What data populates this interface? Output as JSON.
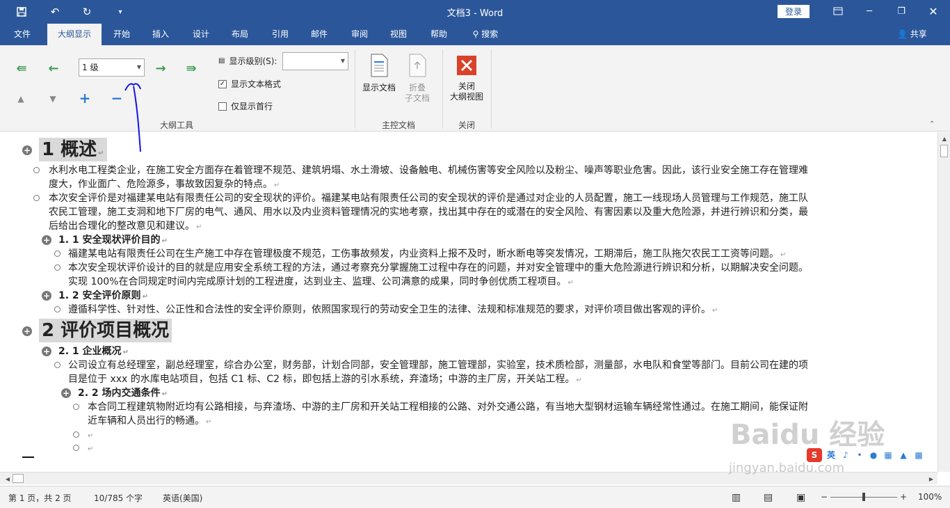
{
  "window": {
    "title": "文档3  -  Word",
    "login": "登录"
  },
  "tabs": [
    {
      "label": "文件"
    },
    {
      "label": "大纲显示"
    },
    {
      "label": "开始"
    },
    {
      "label": "插入"
    },
    {
      "label": "设计"
    },
    {
      "label": "布局"
    },
    {
      "label": "引用"
    },
    {
      "label": "邮件"
    },
    {
      "label": "审阅"
    },
    {
      "label": "视图"
    },
    {
      "label": "帮助"
    },
    {
      "label": "搜索"
    }
  ],
  "share_label": "共享",
  "ribbon": {
    "level_value": "1 级",
    "show_level_label": "显示级别(S):",
    "show_level_value": "",
    "show_text_format": "显示文本格式",
    "show_first_line": "仅显示首行",
    "outline_tools_label": "大纲工具",
    "show_document": "显示文档",
    "collapse_subdoc_1": "折叠",
    "collapse_subdoc_2": "子文档",
    "master_doc_label": "主控文档",
    "close_outline_1": "关闭",
    "close_outline_2": "大纲视图",
    "close_group_label": "关闭"
  },
  "doc": {
    "h1_1": "1  概述",
    "p1a": "水利水电工程类企业，在施工安全方面存在着管理不规范、建筑坍塌、水土滑坡、设备触电、机械伤害等安全风险以及粉尘、噪声等职业危害。因此，该行业安全施工存在管理难",
    "p1b": "度大，作业面广、危险源多，事故致因复杂的特点。",
    "p2a": "本次安全评价是对福建某电站有限责任公司的安全现状的评价。福建某电站有限责任公司的安全现状的评价是通过对企业的人员配置，施工一线现场人员管理与工作规范，施工队",
    "p2b": "农民工管理，施工支洞和地下厂房的电气、通风、用水以及内业资料管理情况的实地考察，找出其中存在的或潜在的安全风险、有害因素以及重大危险源，并进行辨识和分类，最",
    "p2c": "后给出合理化的整改意见和建议。",
    "h2_1": "1. 1 安全现状评价目的",
    "p3": "福建某电站有限责任公司在生产施工中存在管理极度不规范，工伤事故频发，内业资料上报不及时，断水断电等突发情况，工期滞后，施工队拖欠农民工工资等问题。",
    "p4a": "本次安全现状评价设计的目的就是应用安全系统工程的方法，通过考察充分掌握施工过程中存在的问题，并对安全管理中的重大危险源进行辨识和分析，以期解决安全问题。",
    "p4b": "实现 100%在合同规定时间内完成原计划的工程进度，达到业主、监理、公司满意的成果，同时争创优质工程项目。",
    "h2_2": "1. 2 安全评价原则",
    "p5": "遵循科学性、针对性、公正性和合法性的安全评价原则，依照国家现行的劳动安全卫生的法律、法规和标准规范的要求，对评价项目做出客观的评价。",
    "h1_2": "2  评价项目概况",
    "h2_3": "2. 1 企业概况",
    "p6a": "公司设立有总经理室，副总经理室，综合办公室，财务部，计划合同部，安全管理部，施工管理部，实验室，技术质检部，测量部，水电队和食堂等部门。目前公司在建的项",
    "p6b": "目是位于 xxx 的水库电站项目，包括 C1 标、C2 标，即包括上游的引水系统，弃渣场；中游的主厂房，开关站工程。",
    "h3_1": "2. 2 场内交通条件",
    "p7a": "本合同工程建筑物附近均有公路相接，与弃渣场、中游的主厂房和开关站工程相接的公路、对外交通公路，有当地大型钢材运输车辆经常性通过。在施工期间，能保证附",
    "p7b": "近车辆和人员出行的畅通。",
    "para_mark": "↵"
  },
  "status": {
    "page": "第 1 页，共 2 页",
    "words": "10/785 个字",
    "lang": "英语(美国)",
    "zoom": "100%"
  },
  "ime": {
    "lang": "英"
  },
  "watermark": {
    "brand": "Baidu 经验",
    "url": "jingyan.baidu.com"
  }
}
